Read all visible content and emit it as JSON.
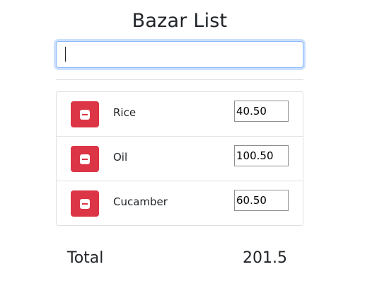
{
  "header": {
    "title": "Bazar List"
  },
  "search": {
    "value": "",
    "placeholder": ""
  },
  "items": [
    {
      "name": "Rice",
      "price": "40.50",
      "remove_icon": "minus-circle-icon"
    },
    {
      "name": "Oil",
      "price": "100.50",
      "remove_icon": "minus-circle-icon"
    },
    {
      "name": "Cucamber",
      "price": "60.50",
      "remove_icon": "minus-circle-icon"
    }
  ],
  "summary": {
    "label": "Total",
    "value": "201.5"
  },
  "colors": {
    "danger": "#dc3545",
    "focus_border": "#86b7fe",
    "text": "#212529",
    "border": "#dee2e6"
  }
}
